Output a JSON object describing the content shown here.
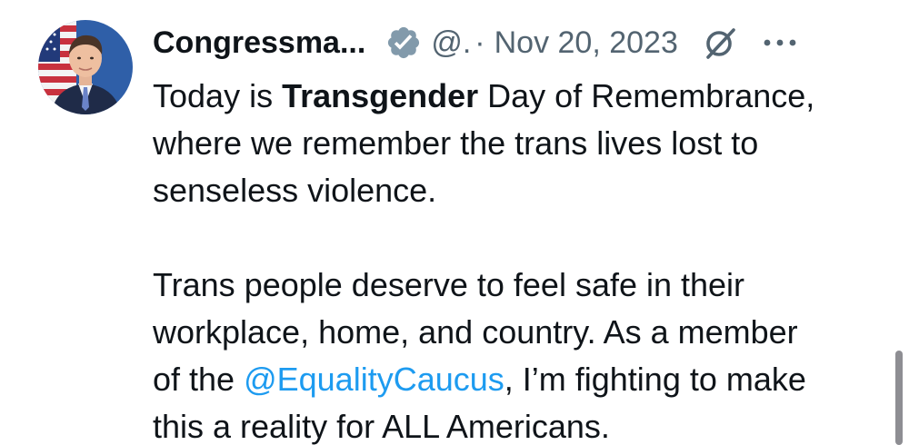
{
  "tweet": {
    "author": {
      "display_name": "Congressma...",
      "handle": "@.",
      "verified": true,
      "verified_color": "#829aab"
    },
    "separator": "·",
    "date": "Nov 20, 2023",
    "icons": {
      "avatar": "avatar-photo",
      "verified": "verified-badge-icon",
      "edited": "grok-slash-icon",
      "more": "more-options-icon"
    },
    "body": {
      "p1": {
        "l1": {
          "a": "Today is ",
          "b": "Transgender",
          "c": " Day of Remembrance,"
        },
        "l2": "where we remember the trans lives lost to",
        "l3": "senseless violence."
      },
      "p2": {
        "l1": "Trans people deserve to feel safe in their",
        "l2": "workplace, home, and country. As a member",
        "l3": {
          "a": "of the ",
          "mention": "@EqualityCaucus",
          "c": ", I’m fighting to make"
        },
        "l4": "this a reality for ALL Americans."
      }
    },
    "colors": {
      "text": "#0f1419",
      "muted": "#536471",
      "link": "#1d9bf0"
    }
  }
}
